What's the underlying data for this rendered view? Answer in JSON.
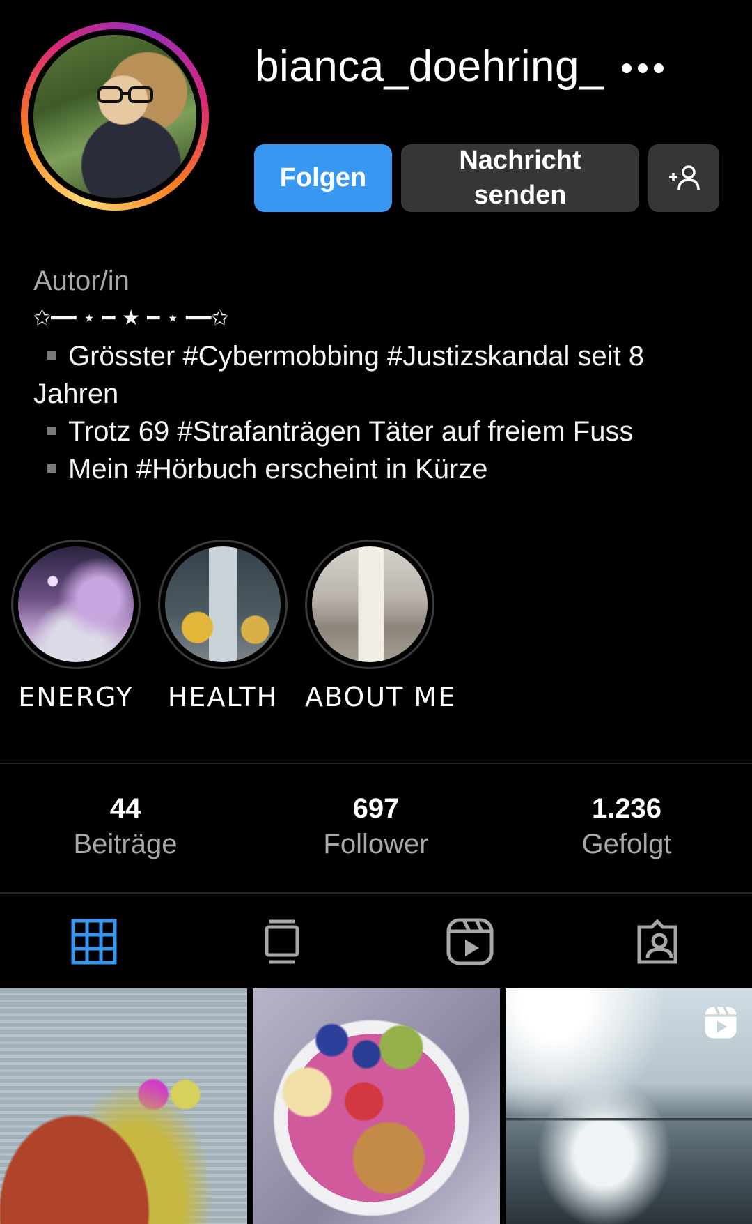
{
  "profile": {
    "username": "bianca_doehring_",
    "follow_label": "Folgen",
    "message_label_line1": "Nachricht",
    "message_label_line2": "senden",
    "add_person_icon": "add-person-icon",
    "more_icon": "more-options-icon"
  },
  "bio": {
    "category": "Autor/in",
    "divider": "✩━━ ⋆ ━ ★ ━ ⋆ ━━✩",
    "lines": [
      "Grösster #Cybermobbing #Justizskandal seit 8 Jahren",
      "Trotz 69 #Strafanträgen Täter auf freiem Fuss",
      "Mein #Hörbuch erscheint in Kürze"
    ]
  },
  "highlights": [
    {
      "label": "ENERGY"
    },
    {
      "label": "HEALTH"
    },
    {
      "label": "ABOUT ME"
    }
  ],
  "stats": [
    {
      "value": "44",
      "label": "Beiträge"
    },
    {
      "value": "697",
      "label": "Follower"
    },
    {
      "value": "1.236",
      "label": "Gefolgt"
    }
  ],
  "tabs": [
    {
      "icon": "grid-icon",
      "active": true
    },
    {
      "icon": "guide-icon",
      "active": false
    },
    {
      "icon": "reels-icon",
      "active": false
    },
    {
      "icon": "tagged-icon",
      "active": false
    }
  ],
  "colors": {
    "accent": "#3897f0",
    "button_secondary": "#363636",
    "muted_text": "#a8a8a8"
  }
}
